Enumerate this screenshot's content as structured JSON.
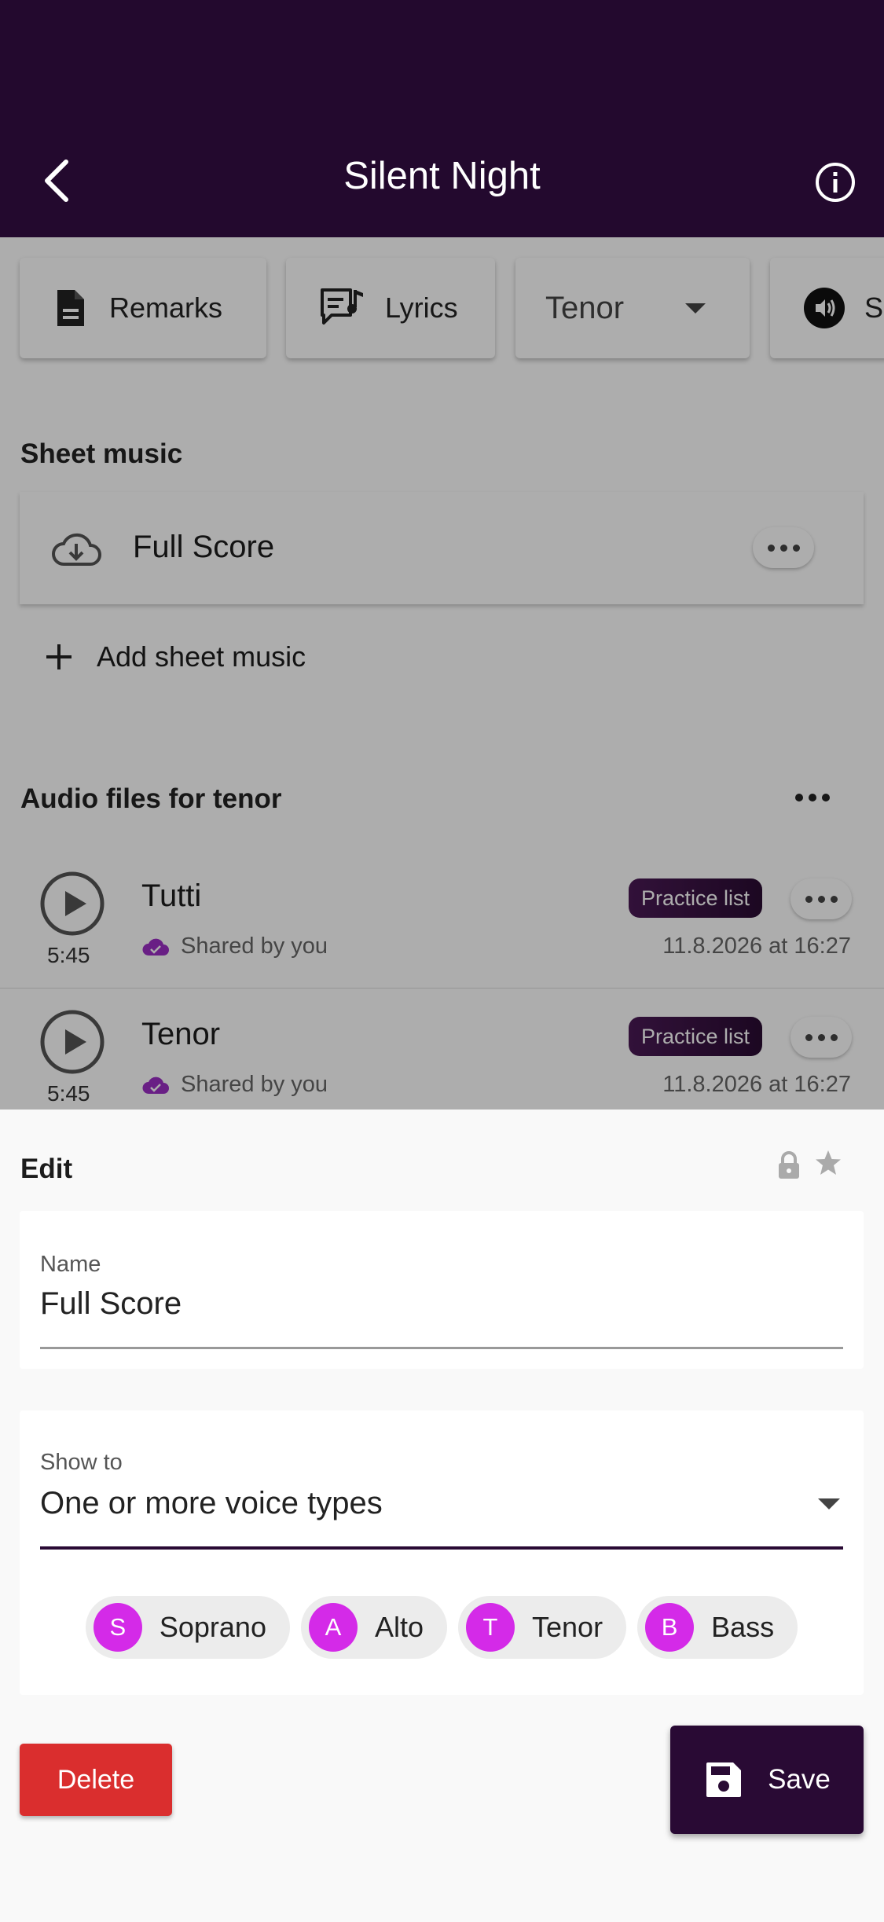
{
  "appbar": {
    "title": "Silent Night",
    "back_icon": "chevron-left-icon",
    "info_icon": "info-icon"
  },
  "toolbar": {
    "remarks_label": "Remarks",
    "lyrics_label": "Lyrics",
    "voice_select": "Tenor",
    "fourth_chip_label": "S"
  },
  "sheet_music": {
    "title": "Sheet music",
    "items": [
      {
        "name": "Full Score"
      }
    ],
    "add_label": "Add sheet music"
  },
  "audio": {
    "title": "Audio files for tenor",
    "items": [
      {
        "name": "Tutti",
        "duration": "5:45",
        "shared": "Shared by you",
        "badge": "Practice list",
        "date": "11.8.2026 at 16:27"
      },
      {
        "name": "Tenor",
        "duration": "5:45",
        "shared": "Shared by you",
        "badge": "Practice list",
        "date": "11.8.2026 at 16:27"
      }
    ]
  },
  "edit_sheet": {
    "title": "Edit",
    "name_label": "Name",
    "name_value": "Full Score",
    "show_to_label": "Show to",
    "show_to_value": "One or more voice types",
    "voices": [
      {
        "initial": "S",
        "label": "Soprano"
      },
      {
        "initial": "A",
        "label": "Alto"
      },
      {
        "initial": "T",
        "label": "Tenor"
      },
      {
        "initial": "B",
        "label": "Bass"
      }
    ],
    "delete_label": "Delete",
    "save_label": "Save"
  },
  "colors": {
    "appbar": "#23092e",
    "accent": "#d42ae8",
    "delete": "#da2e2e",
    "save": "#290a34",
    "cloud_check": "#9b2fc4"
  }
}
